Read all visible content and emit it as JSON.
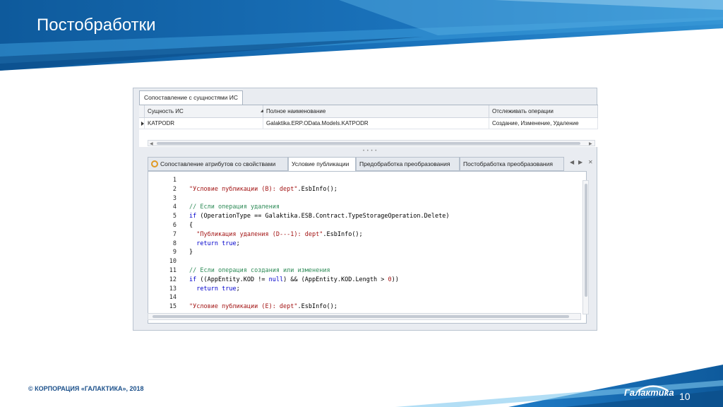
{
  "slide": {
    "title": "Постобработки",
    "copyright": "© КОРПОРАЦИЯ «ГАЛАКТИКА», 2018",
    "page_number": "10",
    "logo_text": "Галактика",
    "colors": {
      "header_dark": "#0e5a9c",
      "header_light": "#2f8fd1",
      "accent": "#7ec8ee"
    }
  },
  "window": {
    "top_tab": "Сопоставление с сущностями ИС",
    "grid": {
      "columns": [
        "Сущность ИС",
        "Полное наименование",
        "Отслеживать операции"
      ],
      "rows": [
        [
          "KATPODR",
          "Galaktika.ERP.OData.Models.KATPODR",
          "Создание, Изменение, Удаление"
        ]
      ]
    },
    "tabs": [
      {
        "label": "Сопоставление атрибутов со свойствами",
        "icon": "gear-icon"
      },
      {
        "label": "Условие публикации",
        "active": true
      },
      {
        "label": "Предобработка преобразования"
      },
      {
        "label": "Постобработка преобразования"
      }
    ],
    "editor": {
      "lines": [
        {
          "n": "1",
          "html": ""
        },
        {
          "n": "2",
          "html": "<span class=\"s\">\"Условие публикации (B): dept\"</span>.EsbInfo();"
        },
        {
          "n": "3",
          "html": ""
        },
        {
          "n": "4",
          "html": "<span class=\"c\">// Если операция удаления</span>"
        },
        {
          "n": "5",
          "html": "<span class=\"k\">if</span> (OperationType == Galaktika.ESB.Contract.TypeStorageOperation.Delete)"
        },
        {
          "n": "6",
          "html": "{"
        },
        {
          "n": "7",
          "html": "  <span class=\"s\">\"Публикация удаления (D---1): dept\"</span>.EsbInfo();"
        },
        {
          "n": "8",
          "html": "  <span class=\"k\">return</span> <span class=\"k\">true</span>;"
        },
        {
          "n": "9",
          "html": "}"
        },
        {
          "n": "10",
          "html": ""
        },
        {
          "n": "11",
          "html": "<span class=\"c\">// Если операция создания или изменения</span>"
        },
        {
          "n": "12",
          "html": "<span class=\"k\">if</span> ((AppEntity.KOD != <span class=\"k\">null</span>) &amp;&amp; (AppEntity.KOD.Length &gt; <span class=\"s\">0</span>))"
        },
        {
          "n": "13",
          "html": "  <span class=\"k\">return</span> <span class=\"k\">true</span>;"
        },
        {
          "n": "14",
          "html": ""
        },
        {
          "n": "15",
          "html": "<span class=\"s\">\"Условие публикации (E): dept\"</span>.EsbInfo();"
        }
      ]
    }
  }
}
